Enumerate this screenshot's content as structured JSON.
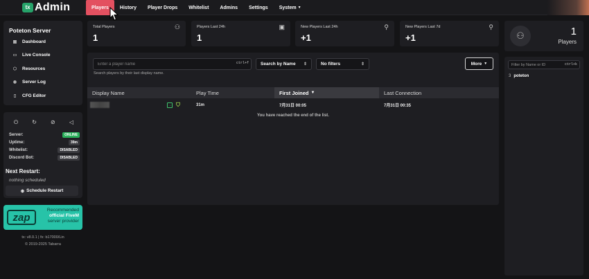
{
  "brand": {
    "logo_mark": "tx",
    "logo_text": "Admin"
  },
  "nav": [
    {
      "label": "Players",
      "active": true
    },
    {
      "label": "History"
    },
    {
      "label": "Player Drops"
    },
    {
      "label": "Whitelist"
    },
    {
      "label": "Admins"
    },
    {
      "label": "Settings"
    },
    {
      "label": "System",
      "has_dropdown": true
    }
  ],
  "server": {
    "name": "Poteton Server",
    "links": [
      {
        "label": "Dashboard",
        "icon": "dashboard-icon"
      },
      {
        "label": "Live Console",
        "icon": "terminal-icon"
      },
      {
        "label": "Resources",
        "icon": "box-icon"
      },
      {
        "label": "Server Log",
        "icon": "eye-icon"
      },
      {
        "label": "CFG Editor",
        "icon": "file-icon"
      }
    ]
  },
  "controls": [
    "power-off-icon",
    "restart-icon",
    "eye-off-icon",
    "megaphone-icon"
  ],
  "status": {
    "server_label": "Server:",
    "server_value": "ONLINE",
    "uptime_label": "Uptime:",
    "uptime_value": "39m",
    "whitelist_label": "Whitelist:",
    "whitelist_value": "DISABLED",
    "discord_label": "Discord Bot:",
    "discord_value": "DISABLED",
    "next_restart_label": "Next Restart:",
    "next_restart_value": "nothing scheduled",
    "schedule_button": "Schedule Restart"
  },
  "promo": {
    "logo": "zap",
    "line1": "Recommended",
    "line2": "official FiveM",
    "line3": "server provider"
  },
  "footer": {
    "version": "tx: v8.0.1 | fx: b17000/Lin",
    "copyright": "© 2019-2025 Tabarra"
  },
  "stats": [
    {
      "label": "Total Players",
      "value": "1",
      "icon": "users-icon"
    },
    {
      "label": "Players Last 24h",
      "value": "1",
      "icon": "calendar-plus-icon"
    },
    {
      "label": "New Players Last 24h",
      "value": "+1",
      "icon": "user-plus-icon"
    },
    {
      "label": "New Players Last 7d",
      "value": "+1",
      "icon": "user-plus-icon"
    }
  ],
  "search": {
    "placeholder": "Enter a player name",
    "shortcut": "ctrl+f",
    "help": "Search players by their last display name.",
    "search_by": "Search by Name",
    "filters": "No filters",
    "more": "More"
  },
  "table": {
    "columns": [
      "Display Name",
      "Play Time",
      "First Joined",
      "Last Connection"
    ],
    "sorted_column": "First Joined",
    "sort_arrow": "▼",
    "rows": [
      {
        "name": "",
        "play_time": "31m",
        "first_joined": "7月31日 00:05",
        "last_connection": "7月31日 00:35"
      }
    ],
    "end_message": "You have reached the end of the list."
  },
  "online": {
    "count": "1",
    "label": "Players",
    "filter_placeholder": "Filter by Name or ID",
    "filter_shortcut": "ctrl+k",
    "players": [
      {
        "id": "3",
        "name": "poteton"
      }
    ]
  }
}
